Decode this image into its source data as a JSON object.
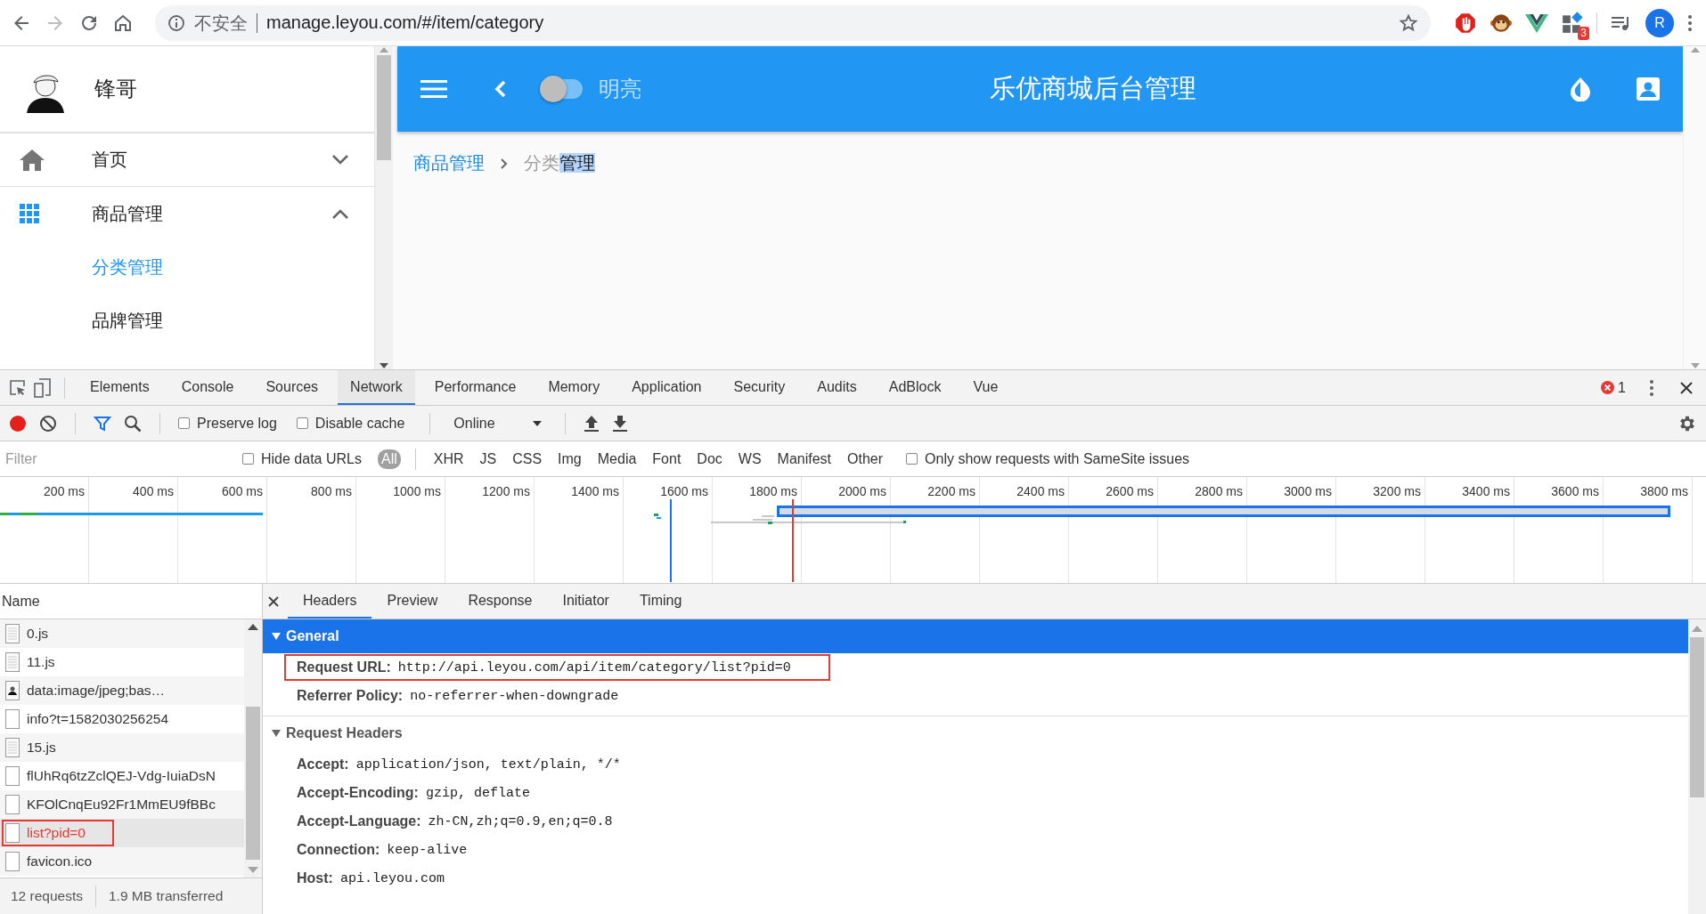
{
  "browser": {
    "security_label": "不安全",
    "url": "manage.leyou.com/#/item/category",
    "extension_badge": "3",
    "profile_initial": "R"
  },
  "sidebar": {
    "user_name": "锋哥",
    "menu": [
      {
        "label": "首页",
        "kind": "home",
        "expanded": false
      },
      {
        "label": "商品管理",
        "kind": "grid",
        "expanded": true,
        "children": [
          {
            "label": "分类管理",
            "selected": true
          },
          {
            "label": "品牌管理",
            "selected": false
          }
        ]
      }
    ]
  },
  "header": {
    "theme_switch": {
      "label": "明亮",
      "on": false
    },
    "title": "乐优商城后台管理"
  },
  "breadcrumb": {
    "link": "商品管理",
    "current": "分类",
    "current_highlighted": "管理"
  },
  "devtools": {
    "tabs": [
      {
        "label": "Elements",
        "selected": false
      },
      {
        "label": "Console",
        "selected": false
      },
      {
        "label": "Sources",
        "selected": false
      },
      {
        "label": "Network",
        "selected": true
      },
      {
        "label": "Performance",
        "selected": false
      },
      {
        "label": "Memory",
        "selected": false
      },
      {
        "label": "Application",
        "selected": false
      },
      {
        "label": "Security",
        "selected": false
      },
      {
        "label": "Audits",
        "selected": false
      },
      {
        "label": "AdBlock",
        "selected": false
      },
      {
        "label": "Vue",
        "selected": false
      }
    ],
    "error_count": "1",
    "recording": true,
    "preserve_log": {
      "label": "Preserve log",
      "checked": false
    },
    "disable_cache": {
      "label": "Disable cache",
      "checked": false
    },
    "throttling": "Online",
    "filter": {
      "placeholder": "Filter"
    },
    "hide_data_urls": {
      "label": "Hide data URLs",
      "checked": false
    },
    "type_filters": [
      {
        "label": "All",
        "selected": true
      },
      {
        "label": "XHR",
        "selected": false
      },
      {
        "label": "JS",
        "selected": false
      },
      {
        "label": "CSS",
        "selected": false
      },
      {
        "label": "Img",
        "selected": false
      },
      {
        "label": "Media",
        "selected": false
      },
      {
        "label": "Font",
        "selected": false
      },
      {
        "label": "Doc",
        "selected": false
      },
      {
        "label": "WS",
        "selected": false
      },
      {
        "label": "Manifest",
        "selected": false
      },
      {
        "label": "Other",
        "selected": false
      }
    ],
    "samesite": {
      "label": "Only show requests with SameSite issues",
      "checked": false
    },
    "timeline_ticks": [
      "200 ms",
      "400 ms",
      "600 ms",
      "800 ms",
      "1000 ms",
      "1200 ms",
      "1400 ms",
      "1600 ms",
      "1800 ms",
      "2000 ms",
      "2200 ms",
      "2400 ms",
      "2600 ms",
      "2800 ms",
      "3000 ms",
      "3200 ms",
      "3400 ms",
      "3600 ms",
      "3800 ms"
    ],
    "requests_header": "Name",
    "requests": [
      {
        "name": "0.js",
        "kind": "script",
        "selected": false,
        "failed": false,
        "annotated": false
      },
      {
        "name": "11.js",
        "kind": "script",
        "selected": false,
        "failed": false,
        "annotated": false
      },
      {
        "name": "data:image/jpeg;bas…",
        "kind": "image",
        "selected": false,
        "failed": false,
        "annotated": false
      },
      {
        "name": "info?t=1582030256254",
        "kind": "other",
        "selected": false,
        "failed": false,
        "annotated": false
      },
      {
        "name": "15.js",
        "kind": "script",
        "selected": false,
        "failed": false,
        "annotated": false
      },
      {
        "name": "flUhRq6tzZclQEJ-Vdg-IuiaDsN",
        "kind": "other",
        "selected": false,
        "failed": false,
        "annotated": false
      },
      {
        "name": "KFOlCnqEu92Fr1MmEU9fBBc",
        "kind": "other",
        "selected": false,
        "failed": false,
        "annotated": false
      },
      {
        "name": "list?pid=0",
        "kind": "other",
        "selected": true,
        "failed": true,
        "annotated": true
      },
      {
        "name": "favicon.ico",
        "kind": "other",
        "selected": false,
        "failed": false,
        "annotated": false
      }
    ],
    "summary": [
      "12 requests",
      "1.9 MB transferred"
    ],
    "detail_tabs": [
      {
        "label": "Headers",
        "selected": true
      },
      {
        "label": "Preview",
        "selected": false
      },
      {
        "label": "Response",
        "selected": false
      },
      {
        "label": "Initiator",
        "selected": false
      },
      {
        "label": "Timing",
        "selected": false
      }
    ],
    "sections": [
      {
        "title": "General",
        "expanded": true,
        "highlighted": true,
        "rows": [
          {
            "name": "Request URL:",
            "value": "http://api.leyou.com/api/item/category/list?pid=0",
            "annotated": true
          },
          {
            "name": "Referrer Policy:",
            "value": "no-referrer-when-downgrade",
            "annotated": false
          }
        ]
      },
      {
        "title": "Request Headers",
        "expanded": true,
        "highlighted": false,
        "rows": [
          {
            "name": "Accept:",
            "value": "application/json, text/plain, */*",
            "annotated": false
          },
          {
            "name": "Accept-Encoding:",
            "value": "gzip, deflate",
            "annotated": false
          },
          {
            "name": "Accept-Language:",
            "value": "zh-CN,zh;q=0.9,en;q=0.8",
            "annotated": false
          },
          {
            "name": "Connection:",
            "value": "keep-alive",
            "annotated": false
          },
          {
            "name": "Host:",
            "value": "api.leyou.com",
            "annotated": false
          }
        ]
      }
    ]
  }
}
